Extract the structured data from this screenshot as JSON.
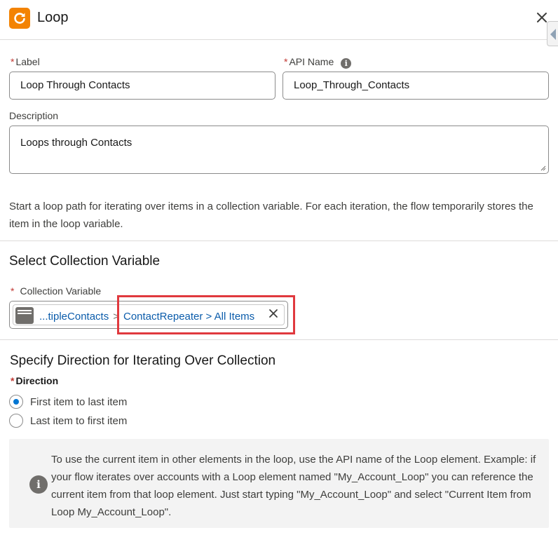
{
  "header": {
    "title": "Loop",
    "app_icon": "refresh-loop-icon",
    "accent_color": "#f38303"
  },
  "form": {
    "label": {
      "required_mark": "*",
      "title": "Label",
      "value": "Loop Through Contacts"
    },
    "api_name": {
      "required_mark": "*",
      "title": "API Name",
      "value": "Loop_Through_Contacts",
      "info_icon": "i"
    },
    "description": {
      "title": "Description",
      "value": "Loops through Contacts"
    }
  },
  "help_text": "Start a loop path for iterating over items in a collection variable. For each iteration, the flow temporarily stores the item in the loop variable.",
  "collection": {
    "section_title": "Select Collection Variable",
    "field_required_mark": "*",
    "field_title": "Collection Variable",
    "pill_prefix": "...tipleContacts",
    "separator": ">",
    "pill_value": "ContactRepeater > All Items"
  },
  "direction": {
    "section_title": "Specify Direction for Iterating Over Collection",
    "required_mark": "*",
    "field_title": "Direction",
    "options": [
      {
        "label": "First item to last item",
        "selected": true
      },
      {
        "label": "Last item to first item",
        "selected": false
      }
    ],
    "selected_color": "#0176d3"
  },
  "note": {
    "icon": "i",
    "text": "To use the current item in other elements in the loop, use the API name of the Loop element. Example: if your flow iterates over accounts with a Loop element named \"My_Account_Loop\" you can reference the current item from that loop element. Just start typing \"My_Account_Loop\" and select \"Current Item from Loop My_Account_Loop\"."
  },
  "highlight_color": "#e0393e"
}
